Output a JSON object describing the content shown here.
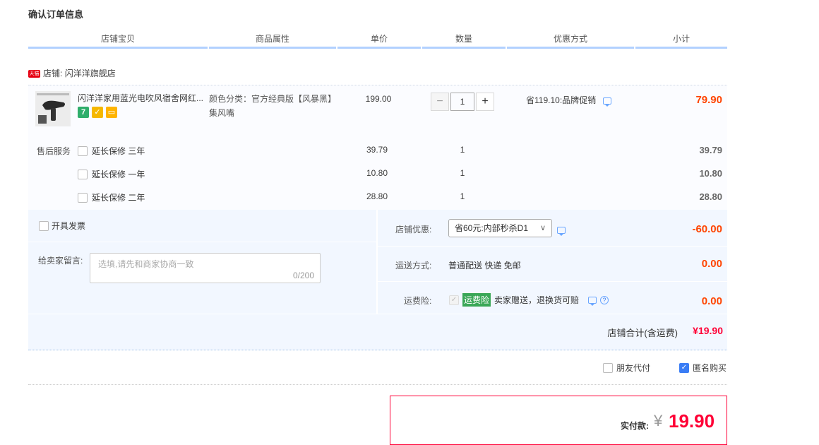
{
  "page_title": "确认订单信息",
  "columns": [
    "店铺宝贝",
    "商品属性",
    "单价",
    "数量",
    "优惠方式",
    "小计"
  ],
  "shop": {
    "badge": "天猫",
    "label": "店铺:",
    "name": "闪洋洋旗舰店"
  },
  "product": {
    "title": "闪洋洋家用蓝光电吹风宿舍网红...",
    "attr_line1": "颜色分类：官方经典版【风暴黑】",
    "attr_line2": "集风嘴",
    "price": "199.00",
    "qty": "1",
    "minus": "−",
    "plus": "+",
    "promo": "省119.10:品牌促销",
    "subtotal": "79.90"
  },
  "after_sale": {
    "label": "售后服务",
    "items": [
      {
        "name": "延长保修 三年",
        "price": "39.79",
        "qty": "1",
        "subtotal": "39.79"
      },
      {
        "name": "延长保修 一年",
        "price": "10.80",
        "qty": "1",
        "subtotal": "10.80"
      },
      {
        "name": "延长保修 二年",
        "price": "28.80",
        "qty": "1",
        "subtotal": "28.80"
      }
    ]
  },
  "invoice_label": "开具发票",
  "message": {
    "label": "给卖家留言:",
    "placeholder": "选填,请先和商家协商一致",
    "counter": "0/200"
  },
  "coupon": {
    "label": "店铺优惠:",
    "selected": "省60元:内部秒杀D1",
    "amount": "-60.00"
  },
  "shipping": {
    "label": "运送方式:",
    "value": "普通配送 快递 免邮",
    "amount": "0.00"
  },
  "insurance": {
    "label": "运费险:",
    "badge": "运费险",
    "desc": "卖家赠送，退换货可赔",
    "amount": "0.00"
  },
  "shop_total": {
    "label": "店铺合计(含运费)",
    "value": "¥19.90"
  },
  "options": {
    "friend_pay": "朋友代付",
    "anonymous": "匿名购买"
  },
  "pay": {
    "label": "实付款:",
    "currency": "¥",
    "amount": "19.90"
  },
  "colors": {
    "accent": "#3a7df5",
    "price_red": "#ff0036",
    "promo_red": "#f40",
    "header_line": "#b2d1ff",
    "panel_bg": "#f2f7ff"
  }
}
